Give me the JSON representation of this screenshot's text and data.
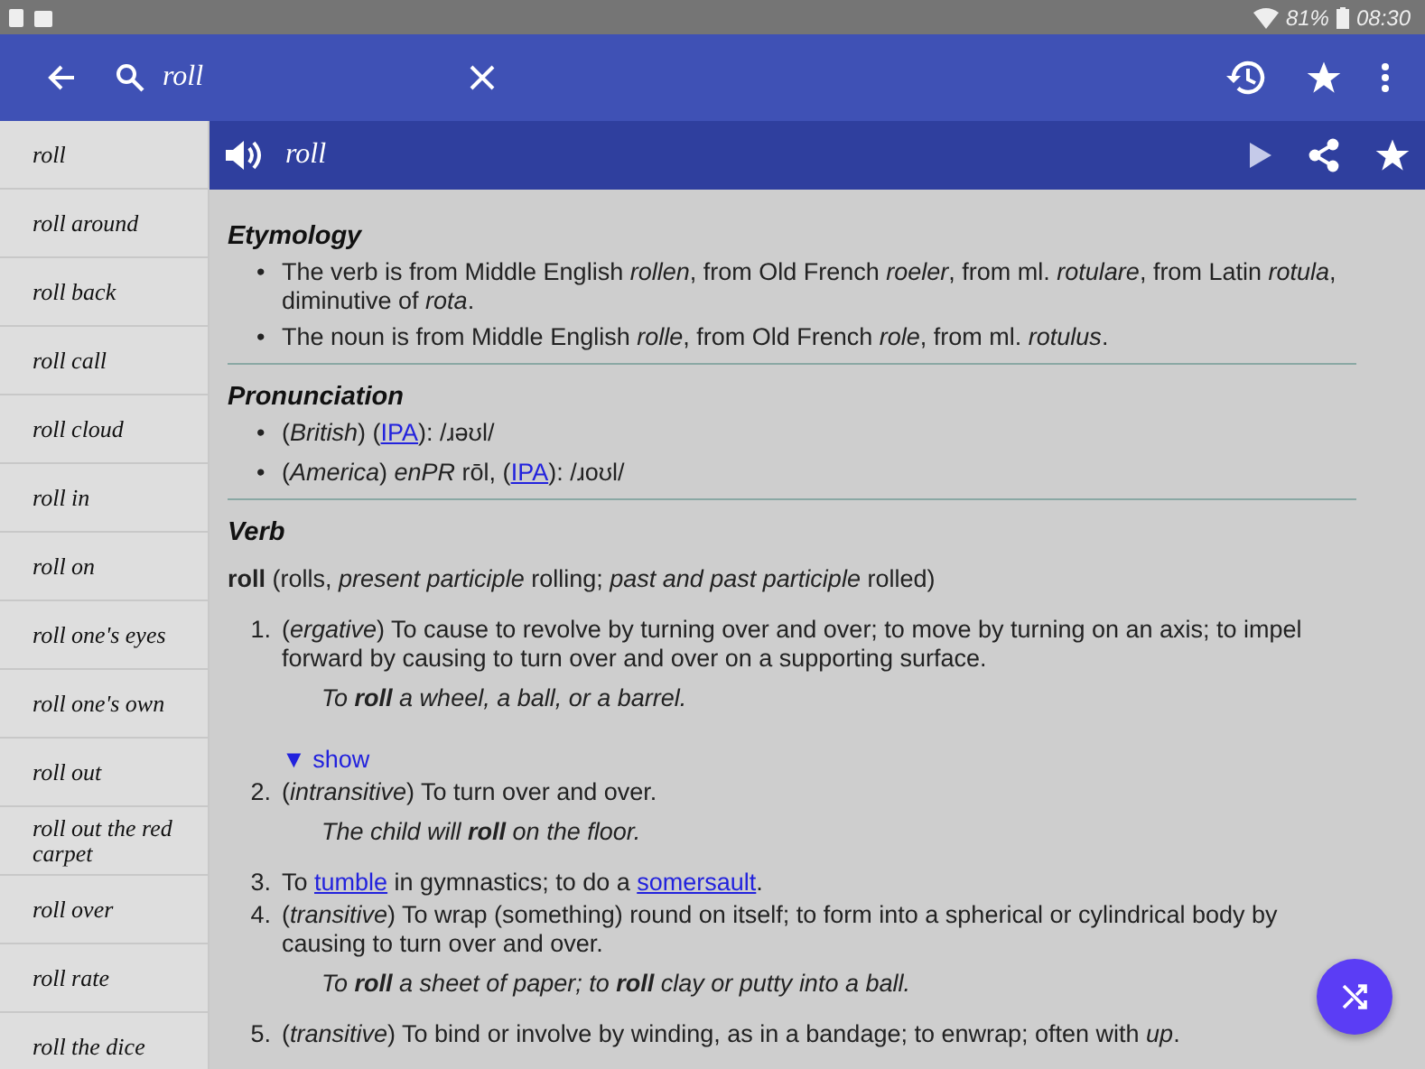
{
  "status_bar": {
    "battery": "81%",
    "time": "08:30"
  },
  "toolbar": {
    "query": "roll"
  },
  "sidebar": {
    "items": [
      {
        "label": "roll"
      },
      {
        "label": "roll around"
      },
      {
        "label": "roll back"
      },
      {
        "label": "roll call"
      },
      {
        "label": "roll cloud"
      },
      {
        "label": "roll in"
      },
      {
        "label": "roll on"
      },
      {
        "label": "roll one's eyes"
      },
      {
        "label": "roll one's own"
      },
      {
        "label": "roll out"
      },
      {
        "label": "roll out the red carpet"
      },
      {
        "label": "roll over"
      },
      {
        "label": "roll rate"
      },
      {
        "label": "roll the dice"
      }
    ]
  },
  "entry": {
    "headword": "roll",
    "etymology": {
      "title": "Etymology",
      "marker": "•",
      "items": [
        "The verb is from Middle English *rollen*, from Old French *roeler*, from ml. *rotulare*, from Latin *rotula*, diminutive of *rota*.",
        "The noun is from Middle English *rolle*, from Old French *role*, from ml. *rotulus*."
      ]
    },
    "pronunciation": {
      "title": "Pronunciation",
      "marker": "•",
      "items": [
        {
          "parts": [
            {
              "kind": "text",
              "text": "(*British*) ("
            },
            {
              "kind": "link",
              "text": "IPA"
            },
            {
              "kind": "text",
              "text": "): /ɹəʊl/"
            }
          ]
        },
        {
          "parts": [
            {
              "kind": "text",
              "text": "(*America*) *enPR* rōl, ("
            },
            {
              "kind": "link",
              "text": "IPA"
            },
            {
              "kind": "text",
              "text": "): /ɹoʊl/"
            }
          ]
        }
      ]
    },
    "verb": {
      "title": "Verb",
      "inflection": "**roll** (rolls, *present participle* rolling; *past and past participle* rolled)",
      "senses": [
        {
          "number": "1.",
          "parts": [
            {
              "kind": "text",
              "text": "(*ergative*) To cause to revolve by turning over and over; to move by turning on an axis; to impel forward by causing to turn over and over on a supporting surface."
            }
          ],
          "examples": [
            "To **roll** a wheel, a ball, or a barrel."
          ],
          "toggle": {
            "icon": "▼",
            "label": "show"
          }
        },
        {
          "number": "2.",
          "parts": [
            {
              "kind": "text",
              "text": "(*intransitive*) To turn over and over."
            }
          ],
          "examples": [
            "The child will **roll** on the floor."
          ]
        },
        {
          "number": "3.",
          "parts": [
            {
              "kind": "text",
              "text": "To "
            },
            {
              "kind": "link",
              "text": "tumble"
            },
            {
              "kind": "text",
              "text": " in gymnastics; to do a "
            },
            {
              "kind": "link",
              "text": "somersault"
            },
            {
              "kind": "text",
              "text": "."
            }
          ]
        },
        {
          "number": "4.",
          "parts": [
            {
              "kind": "text",
              "text": "(*transitive*) To wrap (something) round on itself; to form into a spherical or cylindrical body by causing to turn over and over."
            }
          ],
          "examples": [
            "To **roll** a sheet of paper; to **roll** clay or putty into a ball."
          ]
        },
        {
          "number": "5.",
          "parts": [
            {
              "kind": "text",
              "text": "(*transitive*) To bind or involve by winding, as in a bandage; to enwrap; often with *up*."
            }
          ]
        }
      ]
    }
  }
}
